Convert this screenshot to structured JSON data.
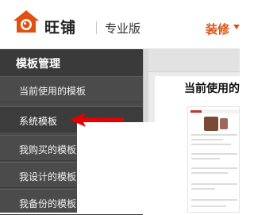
{
  "header": {
    "brand_name": "旺铺",
    "edition": "专业版",
    "decor_menu": "装修",
    "brand_color": "#e0510f"
  },
  "sidebar": {
    "title": "模板管理",
    "items": [
      {
        "label": "当前使用的模板",
        "active": false
      },
      {
        "label": "系统模板",
        "active": true
      },
      {
        "label": "我购买的模板",
        "active": false
      },
      {
        "label": "我设计的模板",
        "active": false
      },
      {
        "label": "我备份的模板",
        "active": false
      }
    ]
  },
  "main": {
    "panel_title": "当前使用的"
  },
  "annotation": {
    "arrow_color": "#e60000",
    "points_to": "系统模板"
  },
  "icons": [
    "logo-house-icon",
    "chevron-down-icon",
    "red-arrow-icon"
  ]
}
